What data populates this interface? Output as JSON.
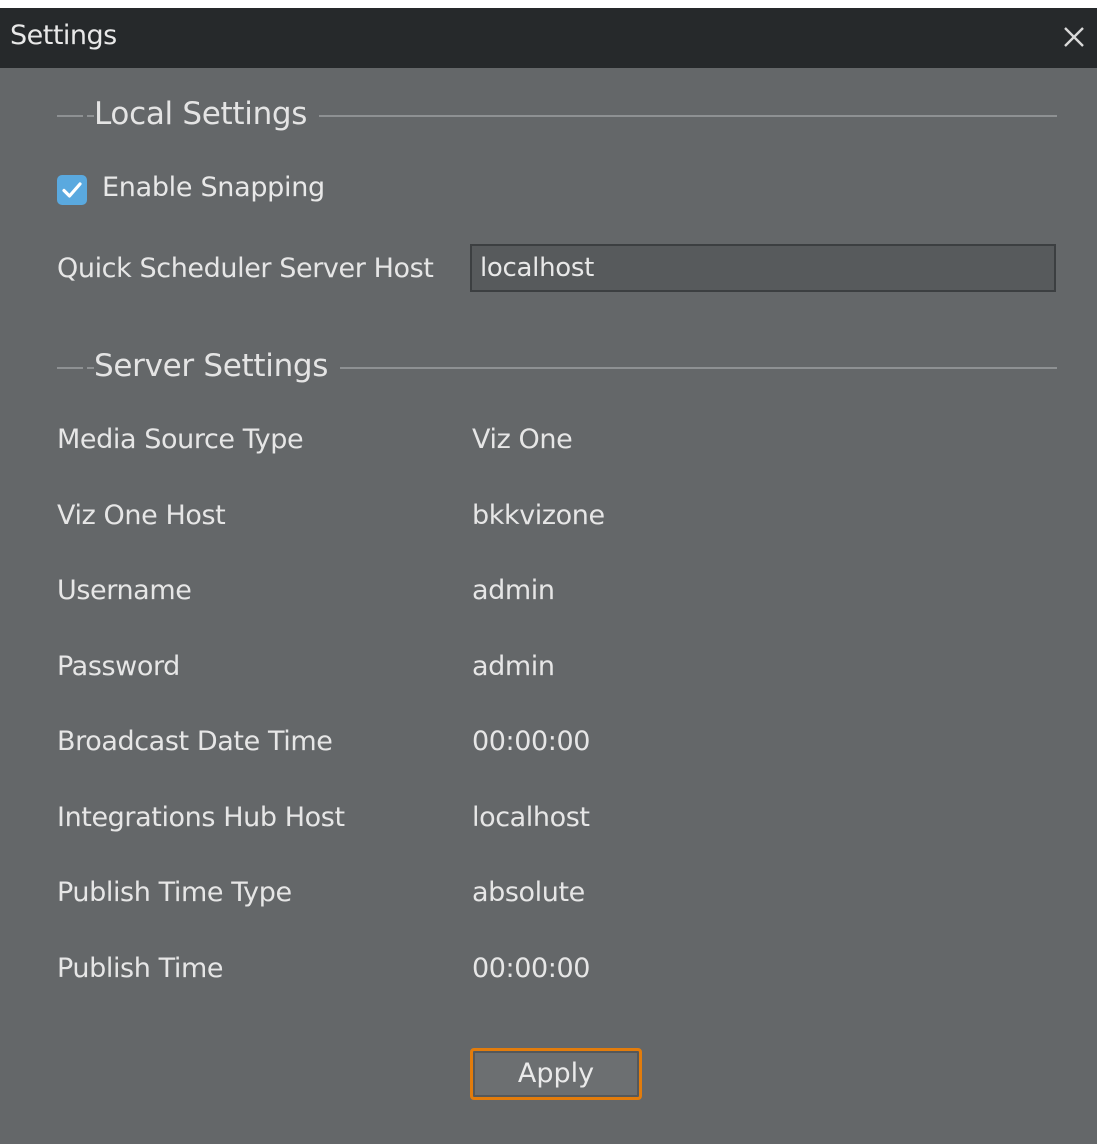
{
  "window": {
    "title": "Settings"
  },
  "local_settings": {
    "header": "Local Settings",
    "enable_snapping": {
      "label": "Enable Snapping",
      "checked": true
    },
    "quick_scheduler_server_host": {
      "label": "Quick Scheduler Server Host",
      "value": "localhost"
    }
  },
  "server_settings": {
    "header": "Server Settings",
    "rows": [
      {
        "label": "Media Source Type",
        "value": "Viz One"
      },
      {
        "label": "Viz One Host",
        "value": "bkkvizone"
      },
      {
        "label": "Username",
        "value": "admin"
      },
      {
        "label": "Password",
        "value": "admin"
      },
      {
        "label": "Broadcast Date Time",
        "value": "00:00:00"
      },
      {
        "label": "Integrations Hub Host",
        "value": "localhost"
      },
      {
        "label": "Publish Time Type",
        "value": "absolute"
      },
      {
        "label": "Publish Time",
        "value": "00:00:00"
      }
    ]
  },
  "actions": {
    "apply_label": "Apply"
  },
  "icons": {
    "close": "close-icon",
    "checkmark": "checkmark-icon"
  },
  "colors": {
    "titlebar": "#26292b",
    "background": "#646769",
    "checkbox_accent": "#5aa9df",
    "focus_border": "#e27c0c"
  }
}
